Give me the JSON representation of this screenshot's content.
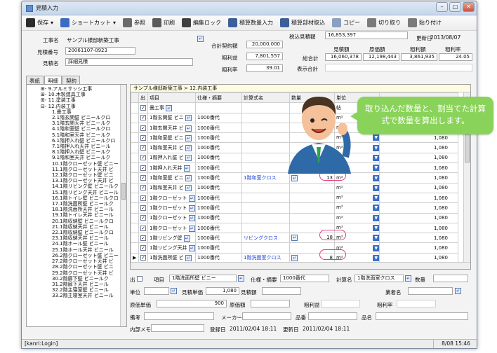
{
  "window": {
    "title": "見積入力",
    "controls": [
      "–",
      "□",
      "✕"
    ]
  },
  "toolbar": [
    {
      "label": "保存",
      "icon": "save-icon",
      "color": "#2b2b2b",
      "caret": "▾"
    },
    {
      "label": "ショートカット",
      "icon": "shortcut-icon",
      "color": "#3c6cbf",
      "caret": "▾"
    },
    {
      "label": "参照",
      "icon": "reference-icon",
      "color": "#6a6a6a"
    },
    {
      "label": "印刷",
      "icon": "print-icon",
      "color": "#5a5a5a"
    },
    {
      "label": "編集ロック",
      "icon": "lock-icon",
      "color": "#404040"
    },
    {
      "label": "積算数量入力",
      "icon": "quantity-icon",
      "color": "#3a5f9a"
    },
    {
      "label": "積算部材取込",
      "icon": "import-icon",
      "color": "#3a5f9a"
    },
    {
      "label": "コピー",
      "icon": "copy-icon",
      "color": "#8aa0c0"
    },
    {
      "label": "切り取り",
      "icon": "cut-icon",
      "color": "#7a7a7a"
    },
    {
      "label": "貼り付け",
      "icon": "paste-icon",
      "color": "#7a7a7a"
    }
  ],
  "header": {
    "project_label": "工事名",
    "project_value": "サンプル様邸新築工事",
    "number_label": "見積番号",
    "number_value": "20061107-0923",
    "name_label": "見積名",
    "name_value": "詳細見積",
    "contract_label": "合計契約額",
    "contract_value": "20,000,000",
    "gross_label": "粗利益",
    "gross_value": "7,801,557",
    "rate_label": "粗利率",
    "rate_value": "39.01",
    "taxin_label": "税込見積額",
    "taxin_value": "16,853,397",
    "updated_label": "更新日",
    "updated_value": "2013/08/07",
    "col_estimate": "見積額",
    "col_cost": "原価額",
    "col_gross": "粗利額",
    "col_rate": "粗利率",
    "total_label": "総合計",
    "total_estimate": "16,060,378",
    "total_cost": "12,198,443",
    "total_gross": "3,861,935",
    "total_rate": "24.05",
    "display_label": "表示合計"
  },
  "tabs": [
    "表紙",
    "明細",
    "契約"
  ],
  "tree": [
    "⊞- 9.アルミサッシ工事",
    "⊞- 10.木製建具工事",
    "⊞- 11.塗装工事",
    "⊟- 12.内装工事",
    "1.畳工事",
    "2.1階玄関壁 ビニールクロ",
    "3.1階玄関天井 ビニールク",
    "4.1階和室壁 ビニールクロ",
    "5.1階和室天井 ビニールク",
    "6.1階押入れ壁 ビニールクロ",
    "7.1階押入れ天井 ビニール",
    "8.1階押入れ壁 ビニールク",
    "9.1階和室天井 ビニールク",
    "10.1階クローゼット壁 ビニー",
    "11.1階クローゼット天井 ビ",
    "12.1階クローゼット壁 ビニ",
    "13.1階クローゼット天井 ビ",
    "14.1階リビング壁 ビニールク",
    "15.1階リビング天井 ビニール",
    "16.1階トイレ壁 ビニールクロ",
    "17.1階洗面所壁 ビニールク",
    "18.1階洗面所天井 ビニール",
    "19.1階トイレ天井 ビニール",
    "20.1階収納壁 ビニールクロ",
    "21.1階収納天井 ビニール",
    "22.1階収納壁 ビニールクロ",
    "23.1階収納天井 ビニール",
    "24.1階ホール壁 ビニール",
    "25.1階ホール天井 ビニール",
    "26.2階クローゼット壁 ビニー",
    "27.2階クローゼット天井 ビ",
    "28.2階クローゼット壁 ビニ",
    "29.2階クローゼット天井 ビ",
    "30.2階廊下壁 ビニールク",
    "31.2階廊下天井 ビニール",
    "32.2階主寝室壁 ビニール",
    "33.2階主寝室天井 ビニール"
  ],
  "grid": {
    "breadcrumb": "サンプル様邸新築工事 > 12.内装工事",
    "headers": [
      "出",
      "項目",
      "仕様・摘要",
      "計算式名",
      "数量",
      "単位"
    ],
    "rows": [
      {
        "item": "畳工事",
        "spec": "",
        "formula": "",
        "qty": "",
        "unit": "帖",
        "amount": ""
      },
      {
        "item": "1階玄関壁 ビニ",
        "spec": "1000番代",
        "formula": "",
        "qty": "",
        "unit": "m²",
        "amount": "1,080"
      },
      {
        "item": "1階玄関天井 ビ",
        "spec": "1000番代",
        "formula": "",
        "qty": "",
        "unit": "m²",
        "amount": "1,080"
      },
      {
        "item": "1階和室壁 ビニ",
        "spec": "1000番代",
        "formula": "",
        "qty": "",
        "unit": "m²",
        "amount": "1,080"
      },
      {
        "item": "1階和室天井 ビ",
        "spec": "1000番代",
        "formula": "",
        "qty": "",
        "unit": "m²",
        "amount": "1,080"
      },
      {
        "item": "1階押入れ壁 ビ",
        "spec": "1000番代",
        "formula": "",
        "qty": "",
        "unit": "m²",
        "amount": "1,080"
      },
      {
        "item": "1階押入れ天井",
        "spec": "1000番代",
        "formula": "",
        "qty": "",
        "unit": "m²",
        "amount": "1,080"
      },
      {
        "item": "1階和室壁 ビニ",
        "spec": "1000番代",
        "formula": "1階和室クロス",
        "qty": "13",
        "unit": "m²",
        "amount": "1,080"
      },
      {
        "item": "1階和室天井 ビ",
        "spec": "1000番代",
        "formula": "",
        "qty": "",
        "unit": "m²",
        "amount": "1,080"
      },
      {
        "item": "1階クローゼット",
        "spec": "1000番代",
        "formula": "",
        "qty": "",
        "unit": "m²",
        "amount": "1,080"
      },
      {
        "item": "1階クローゼット",
        "spec": "1000番代",
        "formula": "",
        "qty": "",
        "unit": "m²",
        "amount": "1,080"
      },
      {
        "item": "1階クローゼット",
        "spec": "1000番代",
        "formula": "",
        "qty": "",
        "unit": "m²",
        "amount": "1,080"
      },
      {
        "item": "1階クローゼット",
        "spec": "1000番代",
        "formula": "",
        "qty": "",
        "unit": "m²",
        "amount": "1,080"
      },
      {
        "item": "1階リビング壁 ",
        "spec": "1000番代",
        "formula": "リビングクロス",
        "qty": "18",
        "unit": "m²",
        "amount": "1,080"
      },
      {
        "item": "1階リビング天井",
        "spec": "1000番代",
        "formula": "",
        "qty": "",
        "unit": "m²",
        "amount": "1,080"
      },
      {
        "item": "1階洗面所壁 ビ",
        "spec": "1000番代",
        "formula": "1階洗面室クロス",
        "qty": "8",
        "unit": "m²",
        "amount": "1,080"
      },
      {
        "item": "1階洗面所天井",
        "spec": "1000番代",
        "formula": "",
        "qty": "",
        "unit": "",
        "amount": ""
      }
    ]
  },
  "detail": {
    "out_label": "出",
    "item_label": "項目",
    "item_value": "1階洗面所壁 ビニー",
    "spec_label": "仕様・摘要",
    "spec_value": "1000番代",
    "formula_label": "計算名",
    "formula_value": "1階洗面室クロス",
    "qty_label": "数量",
    "unit_label": "単位",
    "estimate_unit_label": "見積単価",
    "estimate_unit_value": "1,080",
    "estimate_label": "見積額",
    "trader_label": "業者名",
    "cost_unit_label": "原価単価",
    "cost_unit_value": "900",
    "cost_label": "原価額",
    "gross_label": "粗利益",
    "rate_label": "粗利率",
    "note_label": "備考",
    "maker_label": "メーカー",
    "product_no_label": "品番",
    "product_name_label": "品名",
    "memo_label": "内部メモ",
    "registered_label": "登録日",
    "registered_value": "2011/02/04 18:11",
    "updated_label": "更新日",
    "updated_value": "2011/02/04 18:11"
  },
  "status": {
    "user": "[kanri:Login]",
    "clock": "8/08 15:46"
  },
  "callout": {
    "text": "取り込んだ数量と、割当てた計算式で数量を算出します。"
  }
}
